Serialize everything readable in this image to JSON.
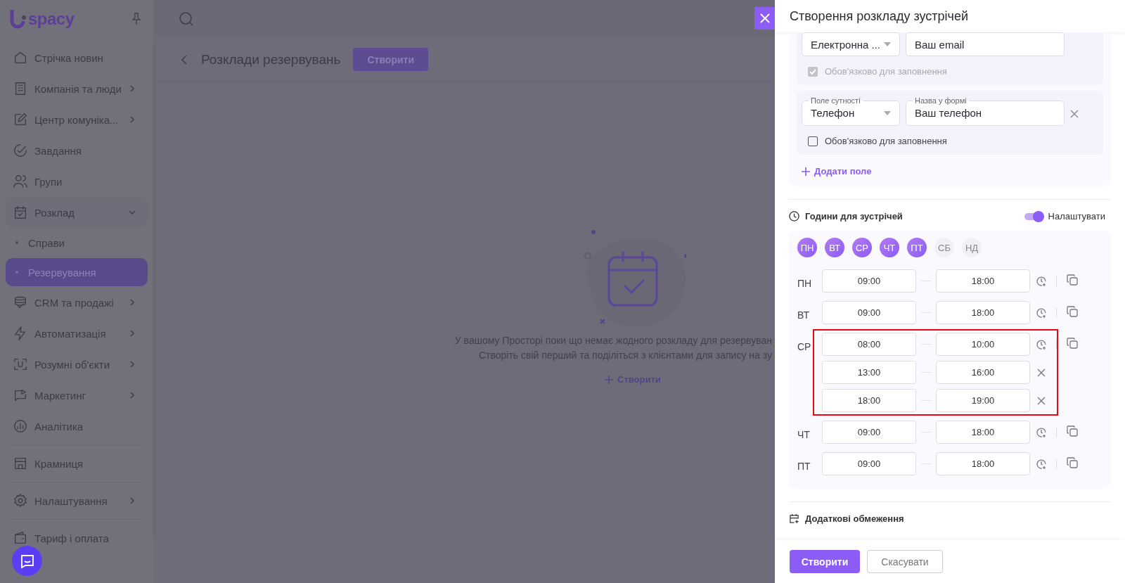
{
  "sidebar": {
    "logo_text": "spacy",
    "groups": [
      [
        {
          "label": "Стрічка новин",
          "selected": false
        },
        {
          "label": "Компанія та люди",
          "selected": false,
          "expanded": false
        },
        {
          "label": "Центр комуніка...",
          "selected": false,
          "expanded": false
        },
        {
          "label": "Завдання",
          "selected": false
        },
        {
          "label": "Групи",
          "selected": false
        },
        {
          "label": "Розклад",
          "selected": false,
          "expanded": true,
          "children": [
            {
              "label": "Справи",
              "selected": false
            },
            {
              "label": "Резервування",
              "selected": true
            }
          ]
        },
        {
          "label": "CRM та продажі",
          "selected": false,
          "expanded": false
        },
        {
          "label": "Автоматизація",
          "selected": false,
          "expanded": false
        },
        {
          "label": "Розумні об'єкти",
          "selected": false,
          "expanded": false
        },
        {
          "label": "Маркетинг",
          "selected": false,
          "expanded": false
        },
        {
          "label": "Аналітика",
          "selected": false
        }
      ],
      [
        {
          "label": "Крамниця",
          "selected": false
        }
      ],
      [
        {
          "label": "Налаштування",
          "selected": false,
          "expanded": false
        }
      ],
      [
        {
          "label": "Тариф і оплата",
          "selected": false
        }
      ]
    ]
  },
  "page": {
    "title": "Розклади резервувань",
    "create_button": "Створити",
    "empty_state": {
      "lines": [
        "У вашому Просторі поки що немає жодного розкладу для резервуван",
        "Створіть свій перший та поділіться з клієнтами для запису на зу"
      ],
      "action": "Створити"
    }
  },
  "drawer": {
    "title": "Створення розкладу зустрічей",
    "fields": [
      {
        "entity_value": "Електронна ...",
        "name_value": "Ваш email",
        "removable": false,
        "required": true,
        "disabled": true,
        "required_label": "Обов'язково для заповнення"
      },
      {
        "entity_label": "Поле сутності",
        "entity_value": "Телефон",
        "name_label": "Назва у формі",
        "name_value": "Ваш телефон",
        "removable": true,
        "required": false,
        "disabled": false,
        "required_label": "Обов'язково для заповнення"
      }
    ],
    "add_field": "Додати поле",
    "hours": {
      "title": "Години для зустрічей",
      "toggle_label": "Налаштувати",
      "toggle_on": true,
      "days": [
        {
          "label": "ПН",
          "selected": true
        },
        {
          "label": "ВТ",
          "selected": true
        },
        {
          "label": "СР",
          "selected": true
        },
        {
          "label": "ЧТ",
          "selected": true
        },
        {
          "label": "ПТ",
          "selected": true
        },
        {
          "label": "СБ",
          "selected": false
        },
        {
          "label": "НД",
          "selected": false
        }
      ],
      "schedule": [
        {
          "day": "ПН",
          "highlighted": false,
          "intervals": [
            {
              "from": "09:00",
              "to": "18:00"
            }
          ]
        },
        {
          "day": "ВТ",
          "highlighted": false,
          "intervals": [
            {
              "from": "09:00",
              "to": "18:00"
            }
          ]
        },
        {
          "day": "СР",
          "highlighted": true,
          "intervals": [
            {
              "from": "08:00",
              "to": "10:00"
            },
            {
              "from": "13:00",
              "to": "16:00"
            },
            {
              "from": "18:00",
              "to": "19:00"
            }
          ]
        },
        {
          "day": "ЧТ",
          "highlighted": false,
          "intervals": [
            {
              "from": "09:00",
              "to": "18:00"
            }
          ]
        },
        {
          "day": "ПТ",
          "highlighted": false,
          "intervals": [
            {
              "from": "09:00",
              "to": "18:00"
            }
          ]
        }
      ]
    },
    "restrictions_title": "Додаткові обмеження",
    "buttons": {
      "primary": "Створити",
      "secondary": "Скасувати"
    }
  }
}
